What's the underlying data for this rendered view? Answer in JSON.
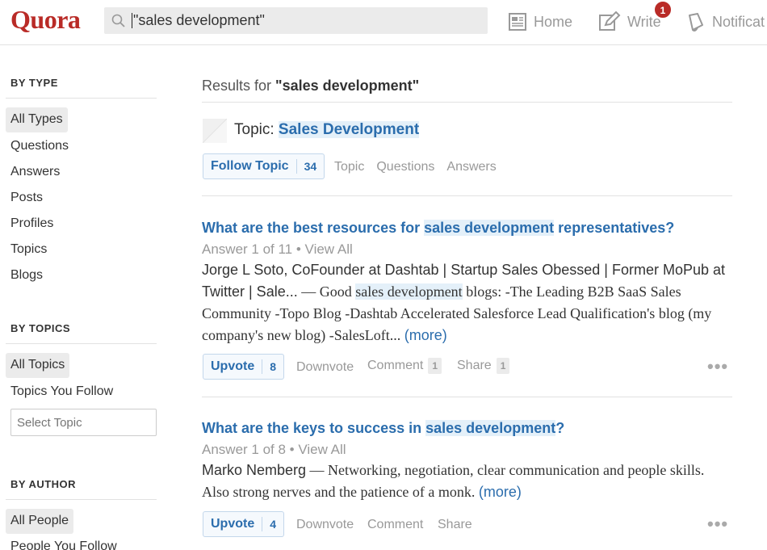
{
  "header": {
    "logo": "Quora",
    "search_value": "\"sales development\"",
    "nav": {
      "home": "Home",
      "write": "Write",
      "notifications": "Notificat",
      "write_badge": "1"
    }
  },
  "sidebar": {
    "by_type": {
      "heading": "BY TYPE",
      "items": [
        "All Types",
        "Questions",
        "Answers",
        "Posts",
        "Profiles",
        "Topics",
        "Blogs"
      ]
    },
    "by_topics": {
      "heading": "BY TOPICS",
      "items": [
        "All Topics",
        "Topics You Follow"
      ],
      "select_placeholder": "Select Topic"
    },
    "by_author": {
      "heading": "BY AUTHOR",
      "items": [
        "All People",
        "People You Follow"
      ]
    }
  },
  "main": {
    "results_prefix": "Results for ",
    "query": "\"sales development\"",
    "topic": {
      "prefix": "Topic: ",
      "name": "Sales Development",
      "follow_label": "Follow Topic",
      "follow_count": "34",
      "tabs": [
        "Topic",
        "Questions",
        "Answers"
      ]
    },
    "results": [
      {
        "title_before": "What are the best resources for ",
        "title_highlight": "sales development",
        "title_after": " representatives?",
        "meta": "Answer 1 of 11 • View All",
        "author": "Jorge L Soto, CoFounder at Dashtab | Startup Sales Obessed | Former MoPub at Twitter | Sale...",
        "dash": " — Good ",
        "body_highlight": "sales development",
        "body_after": " blogs:  -The Leading B2B SaaS Sales Community -Topo Blog -Dashtab Accelerated Salesforce Lead Qualification's blog (my company's new blog) -SalesLoft... ",
        "more": "(more)",
        "upvote_label": "Upvote",
        "upvote_count": "8",
        "downvote": "Downvote",
        "comment": "Comment",
        "comment_count": "1",
        "share": "Share",
        "share_count": "1",
        "dots": "•••"
      },
      {
        "title_before": "What are the keys to success in ",
        "title_highlight": "sales development",
        "title_after": "?",
        "meta": "Answer 1 of 8 • View All",
        "author": "Marko Nemberg",
        "dash": " — ",
        "body_after": "Networking, negotiation, clear communication and people skills. Also strong nerves and the patience of a monk. ",
        "more": "(more)",
        "upvote_label": "Upvote",
        "upvote_count": "4",
        "downvote": "Downvote",
        "comment": "Comment",
        "share": "Share",
        "dots": "•••"
      }
    ]
  }
}
